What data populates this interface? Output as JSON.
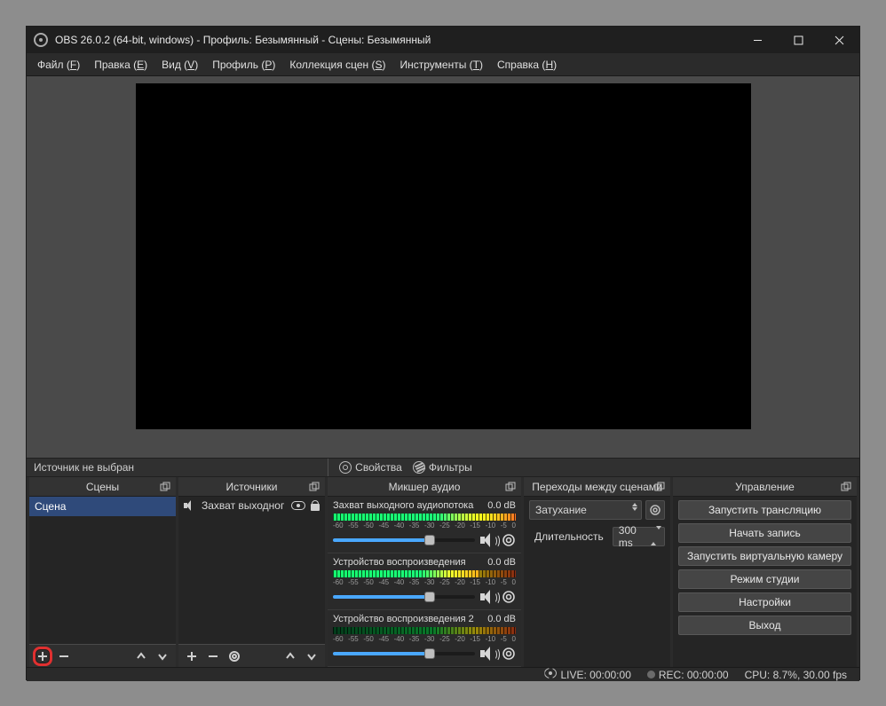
{
  "titlebar": {
    "title": "OBS 26.0.2 (64-bit, windows) - Профиль: Безымянный - Сцены: Безымянный"
  },
  "menu": {
    "file": {
      "label": "Файл",
      "hotkey": "F"
    },
    "edit": {
      "label": "Правка",
      "hotkey": "E"
    },
    "view": {
      "label": "Вид",
      "hotkey": "V"
    },
    "profile": {
      "label": "Профиль",
      "hotkey": "P"
    },
    "scenes": {
      "label": "Коллекция сцен",
      "hotkey": "S"
    },
    "tools": {
      "label": "Инструменты",
      "hotkey": "T"
    },
    "help": {
      "label": "Справка",
      "hotkey": "H"
    }
  },
  "toolstrip": {
    "no_source": "Источник не выбран",
    "properties": "Свойства",
    "filters": "Фильтры"
  },
  "docks": {
    "scenes": {
      "title": "Сцены",
      "items": [
        "Сцена"
      ]
    },
    "sources": {
      "title": "Источники",
      "items": [
        "Захват выходног"
      ]
    },
    "mixer": {
      "title": "Микшер аудио",
      "channels": [
        {
          "name": "Захват выходного аудиопотока",
          "db": "0.0 dB",
          "fill": 68,
          "active": 100
        },
        {
          "name": "Устройство воспроизведения",
          "db": "0.0 dB",
          "fill": 68,
          "active": 80
        },
        {
          "name": "Устройство воспроизведения 2",
          "db": "0.0 dB",
          "fill": 68,
          "active": 0
        }
      ],
      "ticks": [
        "-60",
        "-55",
        "-50",
        "-45",
        "-40",
        "-35",
        "-30",
        "-25",
        "-20",
        "-15",
        "-10",
        "-5",
        "0"
      ]
    },
    "transitions": {
      "title": "Переходы между сценами",
      "current": "Затухание",
      "duration_label": "Длительность",
      "duration_value": "300 ms"
    },
    "controls": {
      "title": "Управление",
      "buttons": [
        "Запустить трансляцию",
        "Начать запись",
        "Запустить виртуальную камеру",
        "Режим студии",
        "Настройки",
        "Выход"
      ]
    }
  },
  "statusbar": {
    "live": "LIVE: 00:00:00",
    "rec": "REC: 00:00:00",
    "cpu": "CPU: 8.7%, 30.00 fps"
  }
}
